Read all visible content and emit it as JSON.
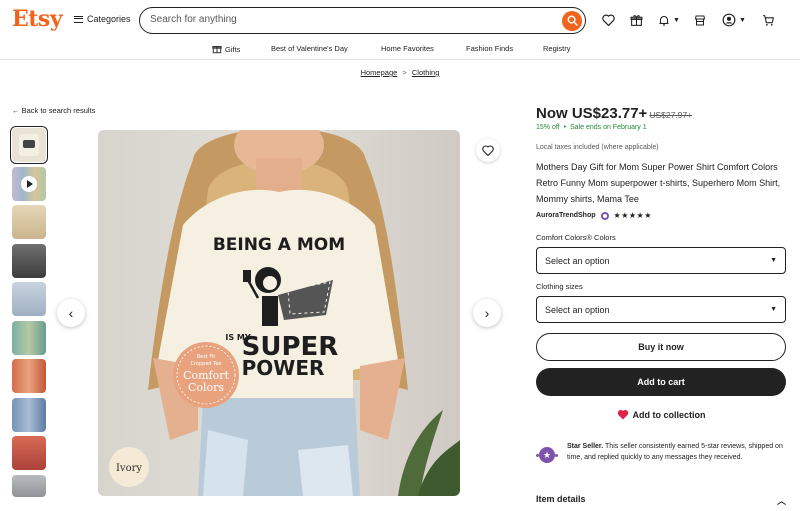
{
  "header": {
    "logo": "Etsy",
    "categories_label": "Categories",
    "search_placeholder": "Search for anything"
  },
  "nav": {
    "items": [
      {
        "label": "Gifts",
        "icon": "gift-icon"
      },
      {
        "label": "Best of Valentine's Day"
      },
      {
        "label": "Home Favorites"
      },
      {
        "label": "Fashion Finds"
      },
      {
        "label": "Registry"
      }
    ]
  },
  "breadcrumb": {
    "home": "Homepage",
    "separator": ">",
    "category": "Clothing"
  },
  "back_link": "Back to search results",
  "image": {
    "shirt_text_top": "BEING A MOM",
    "shirt_text_small": "IS MY",
    "shirt_text_big1": "SUPER",
    "shirt_text_big2": "POWER",
    "badge_line1": "Best Fit",
    "badge_line2": "Cropped Tee",
    "badge_main1": "Comfort",
    "badge_main2": "Colors",
    "color_tag": "Ivory"
  },
  "product": {
    "price": "Now US$23.77+",
    "old_price": "US$27.97+",
    "discount": "15% off",
    "sale_text": "Sale ends on February 1",
    "tax_note": "Local taxes included (where applicable)",
    "title": "Mothers Day Gift for Mom Super Power Shirt Comfort Colors Retro Funny Mom superpower t-shirts, Superhero Mom Shirt, Mommy shirts, Mama Tee",
    "shop_name": "AuroraTrendShop",
    "stars": "★★★★★",
    "rating": 5
  },
  "options": {
    "color_label": "Comfort Colors® Colors",
    "color_value": "Select an option",
    "size_label": "Clothing sizes",
    "size_value": "Select an option"
  },
  "actions": {
    "buy_now": "Buy it now",
    "add_to_cart": "Add to cart",
    "add_to_collection": "Add to collection"
  },
  "seller_note": {
    "title": "Star Seller.",
    "text": "This seller consistently earned 5-star reviews, shipped on time, and replied quickly to any messages they received."
  },
  "item_details": "Item details",
  "colors": {
    "brand": "#f1641e",
    "sale_green": "#258635",
    "star_purple": "#7f53ac",
    "heart_red": "#e0244a"
  }
}
